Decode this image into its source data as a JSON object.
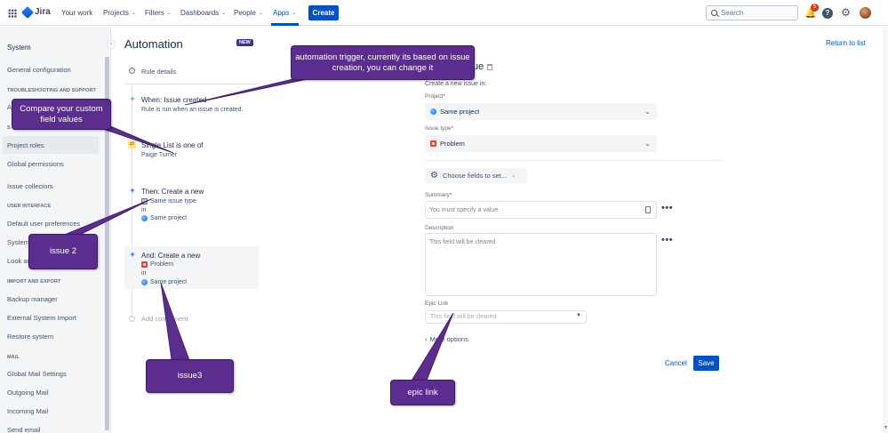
{
  "topnav": {
    "logo": "Jira",
    "items": [
      {
        "label": "Your work",
        "chevron": false
      },
      {
        "label": "Projects",
        "chevron": true
      },
      {
        "label": "Filters",
        "chevron": true
      },
      {
        "label": "Dashboards",
        "chevron": true
      },
      {
        "label": "People",
        "chevron": true
      },
      {
        "label": "Apps",
        "chevron": true,
        "active": true
      }
    ],
    "create_label": "Create",
    "search_placeholder": "Search",
    "notification_count": "5",
    "help_glyph": "?"
  },
  "sidebar": {
    "title": "System",
    "entries": [
      {
        "type": "item",
        "label": "General configuration"
      },
      {
        "type": "section",
        "label": "TROUBLESHOOTING AND SUPPORT"
      },
      {
        "type": "item",
        "label": "A"
      },
      {
        "type": "section",
        "label": "S"
      },
      {
        "type": "item",
        "label": "Project roles",
        "active": true
      },
      {
        "type": "item",
        "label": "Global permissions"
      },
      {
        "type": "item",
        "label": "Issue collectors"
      },
      {
        "type": "section",
        "label": "USER INTERFACE"
      },
      {
        "type": "item",
        "label": "Default user preferences"
      },
      {
        "type": "item",
        "label": "System"
      },
      {
        "type": "item",
        "label": "Look an"
      },
      {
        "type": "section",
        "label": "IMPORT AND EXPORT"
      },
      {
        "type": "item",
        "label": "Backup manager"
      },
      {
        "type": "item",
        "label": "External System Import"
      },
      {
        "type": "item",
        "label": "Restore system"
      },
      {
        "type": "section",
        "label": "MAIL"
      },
      {
        "type": "item",
        "label": "Global Mail Settings"
      },
      {
        "type": "item",
        "label": "Outgoing Mail"
      },
      {
        "type": "item",
        "label": "Incoming Mail"
      },
      {
        "type": "item",
        "label": "Send email"
      }
    ]
  },
  "automation": {
    "title": "Automation",
    "badge": "NEW",
    "return_link": "Return to list",
    "rule_details": "Rule details",
    "steps": {
      "trigger": {
        "title": "When: Issue created",
        "sub": "Rule is run when an issue is created."
      },
      "condition": {
        "title": "Single List is one of",
        "sub": "Paige Turner"
      },
      "action1": {
        "title": "Then: Create a new",
        "type": "Same issue type",
        "in": "in",
        "project": "Same project"
      },
      "action2": {
        "title": "And: Create a new",
        "type": "Problem",
        "in": "in",
        "project": "Same project"
      }
    },
    "add_component": "Add component"
  },
  "form": {
    "title_fragment": "ue",
    "subtitle": "Create a new issue in:",
    "project_label": "Project",
    "project_value": "Same project",
    "issue_type_label": "Issue type",
    "issue_type_value": "Problem",
    "choose_fields": "Choose fields to set...",
    "summary_label": "Summary",
    "summary_placeholder": "You must specify a value",
    "description_label": "Description",
    "description_placeholder": "This field will be cleared",
    "epic_label": "Epic Link",
    "epic_placeholder": "This field will be cleared",
    "more_options": "More options",
    "cancel": "Cancel",
    "save": "Save",
    "required_mark": "*",
    "more_glyph": "•••"
  },
  "annotations": {
    "trigger_note": "automation trigger, currently its based on issue creation, you can change it",
    "custom_field_note": "Compare your custom field values",
    "issue2": "issue 2",
    "issue3": "issue3",
    "epic_link": "epic link"
  },
  "colors": {
    "brand": "#0052cc",
    "callout": "#5b2d8e",
    "sidebar_bg": "#f4f5f7",
    "problem_red": "#e5493a"
  }
}
